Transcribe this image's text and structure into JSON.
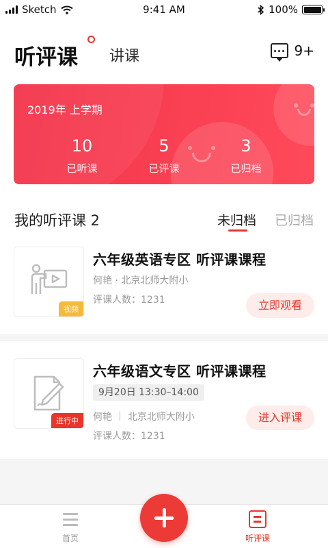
{
  "status_bar": {
    "carrier": "Sketch",
    "time": "9:41 AM",
    "battery": "100%"
  },
  "header": {
    "title": "听评课",
    "secondary_tab": "讲课",
    "message_count": "9+"
  },
  "summary": {
    "term": "2019年 上学期",
    "stats": [
      {
        "value": "10",
        "label": "已听课"
      },
      {
        "value": "5",
        "label": "已评课"
      },
      {
        "value": "3",
        "label": "已归档"
      }
    ]
  },
  "section": {
    "title": "我的听评课 2",
    "tabs": [
      {
        "label": "未归档",
        "active": true
      },
      {
        "label": "已归档",
        "active": false
      }
    ]
  },
  "courses": [
    {
      "title": "六年级英语专区 听评课课程",
      "teacher_school": "何艳 · 北京北师大附小",
      "reviewers": "评课人数：1231",
      "tag": "视频",
      "action": "立即观看",
      "thumb_icon": "teacher-board-icon"
    },
    {
      "title": "六年级语文专区 听评课课程",
      "time": "9月20日 13:30–14:00",
      "teacher_school": "何艳 ｜ 北京北师大附小",
      "reviewers": "评课人数：1231",
      "tag": "进行中",
      "action": "进入评课",
      "thumb_icon": "document-pen-icon"
    }
  ],
  "tabbar": {
    "home": "首页",
    "listen": "听评课"
  },
  "colors": {
    "accent": "#e8362c",
    "banner_start": "#f3334a",
    "banner_end": "#ff4a5a",
    "tag_video": "#f6b93a"
  }
}
